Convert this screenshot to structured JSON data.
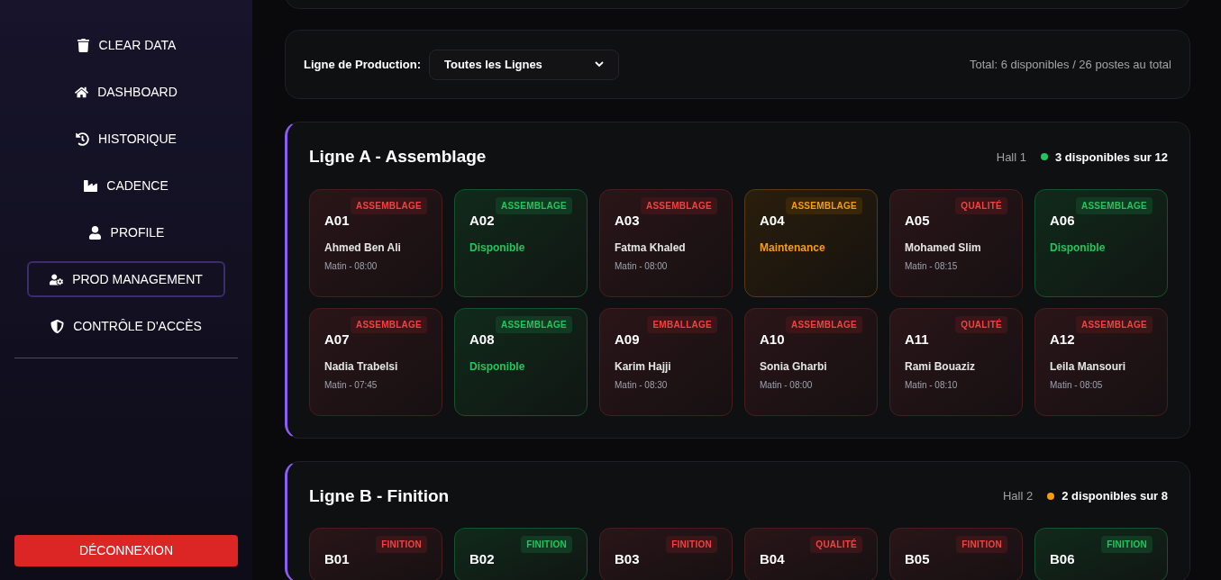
{
  "sidebar": {
    "items": [
      {
        "label": "CLEAR DATA",
        "selected": false
      },
      {
        "label": "DASHBOARD",
        "selected": false
      },
      {
        "label": "HISTORIQUE",
        "selected": false
      },
      {
        "label": "CADENCE",
        "selected": false
      },
      {
        "label": "PROFILE",
        "selected": false
      },
      {
        "label": "PROD MANAGEMENT",
        "selected": true
      },
      {
        "label": "CONTRÔLE D'ACCÈS",
        "selected": false
      }
    ],
    "logout": "DÉCONNEXION"
  },
  "filter": {
    "label": "Ligne de Production:",
    "value": "Toutes les Lignes",
    "total": "Total: 6 disponibles / 26 postes au total"
  },
  "lines": [
    {
      "title": "Ligne A - Assemblage",
      "hall": "Hall 1",
      "availability": "3 disponibles sur 12",
      "color": "#22c55e",
      "stations": [
        {
          "id": "A01",
          "badge": "ASSEMBLAGE",
          "kind": "occupied",
          "name": "Ahmed Ben Ali",
          "shift": "Matin - 08:00"
        },
        {
          "id": "A02",
          "badge": "ASSEMBLAGE",
          "kind": "available",
          "status": "Disponible"
        },
        {
          "id": "A03",
          "badge": "ASSEMBLAGE",
          "kind": "occupied",
          "name": "Fatma Khaled",
          "shift": "Matin - 08:00"
        },
        {
          "id": "A04",
          "badge": "ASSEMBLAGE",
          "kind": "maintenance",
          "status": "Maintenance"
        },
        {
          "id": "A05",
          "badge": "QUALITÉ",
          "kind": "occupied",
          "name": "Mohamed Slim",
          "shift": "Matin - 08:15"
        },
        {
          "id": "A06",
          "badge": "ASSEMBLAGE",
          "kind": "available",
          "status": "Disponible"
        },
        {
          "id": "A07",
          "badge": "ASSEMBLAGE",
          "kind": "occupied",
          "name": "Nadia Trabelsi",
          "shift": "Matin - 07:45"
        },
        {
          "id": "A08",
          "badge": "ASSEMBLAGE",
          "kind": "available",
          "status": "Disponible"
        },
        {
          "id": "A09",
          "badge": "EMBALLAGE",
          "kind": "occupied",
          "name": "Karim Hajji",
          "shift": "Matin - 08:30"
        },
        {
          "id": "A10",
          "badge": "ASSEMBLAGE",
          "kind": "occupied",
          "name": "Sonia Gharbi",
          "shift": "Matin - 08:00"
        },
        {
          "id": "A11",
          "badge": "QUALITÉ",
          "kind": "occupied",
          "name": "Rami Bouaziz",
          "shift": "Matin - 08:10"
        },
        {
          "id": "A12",
          "badge": "ASSEMBLAGE",
          "kind": "occupied",
          "name": "Leila Mansouri",
          "shift": "Matin - 08:05"
        }
      ]
    },
    {
      "title": "Ligne B - Finition",
      "hall": "Hall 2",
      "availability": "2 disponibles sur 8",
      "color": "#f59e0b",
      "stations": [
        {
          "id": "B01",
          "badge": "FINITION",
          "kind": "occupied"
        },
        {
          "id": "B02",
          "badge": "FINITION",
          "kind": "available"
        },
        {
          "id": "B03",
          "badge": "FINITION",
          "kind": "occupied"
        },
        {
          "id": "B04",
          "badge": "QUALITÉ",
          "kind": "occupied"
        },
        {
          "id": "B05",
          "badge": "FINITION",
          "kind": "occupied"
        },
        {
          "id": "B06",
          "badge": "FINITION",
          "kind": "available"
        }
      ]
    }
  ]
}
